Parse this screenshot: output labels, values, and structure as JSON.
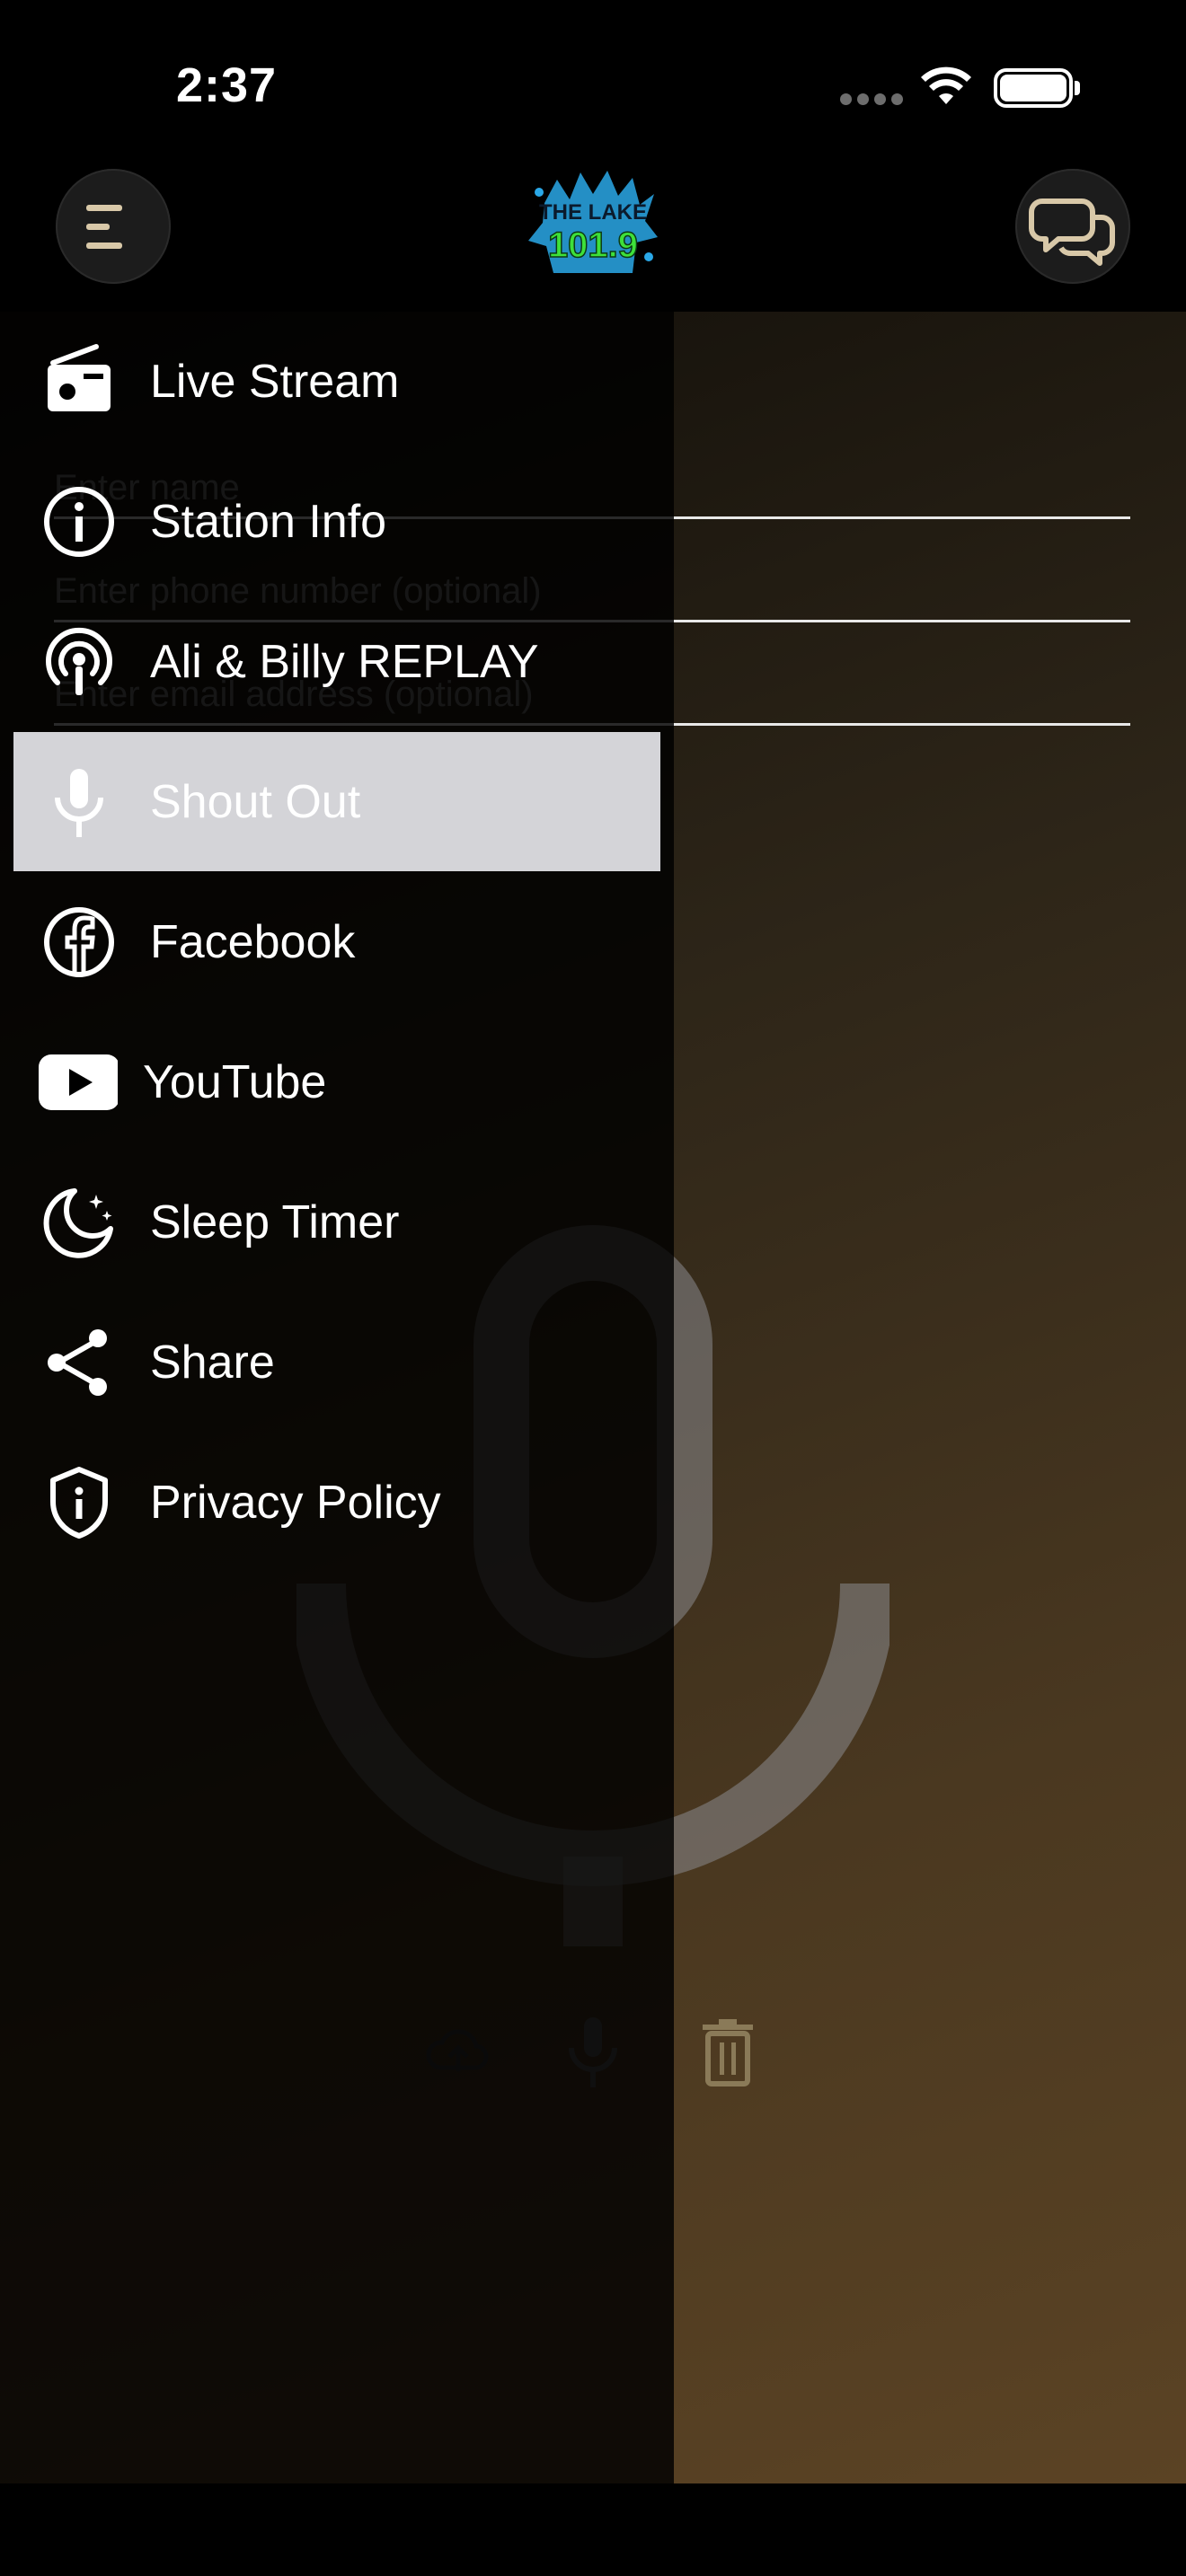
{
  "status_bar": {
    "time": "2:37"
  },
  "header": {
    "logo_text_top": "THE LAKE",
    "logo_text_bottom": "101.9"
  },
  "form": {
    "name_placeholder": "Enter name",
    "phone_placeholder": "Enter phone number (optional)",
    "email_placeholder": "Enter email address (optional)"
  },
  "drawer": {
    "items": [
      {
        "label": "Live Stream",
        "icon": "radio-icon"
      },
      {
        "label": "Station Info",
        "icon": "info-icon"
      },
      {
        "label": "Ali & Billy REPLAY",
        "icon": "podcast-icon"
      },
      {
        "label": "Shout Out",
        "icon": "microphone-icon",
        "selected": true
      },
      {
        "label": "Facebook",
        "icon": "facebook-icon"
      },
      {
        "label": "YouTube",
        "icon": "youtube-icon"
      },
      {
        "label": "Sleep Timer",
        "icon": "moon-icon"
      },
      {
        "label": "Share",
        "icon": "share-icon"
      },
      {
        "label": "Privacy Policy",
        "icon": "shield-icon"
      }
    ]
  },
  "colors": {
    "accent": "#d8c8a8",
    "selected_bg": "#d4d4d8",
    "logo_green": "#3ee03a",
    "logo_blue": "#2aa8e8"
  }
}
